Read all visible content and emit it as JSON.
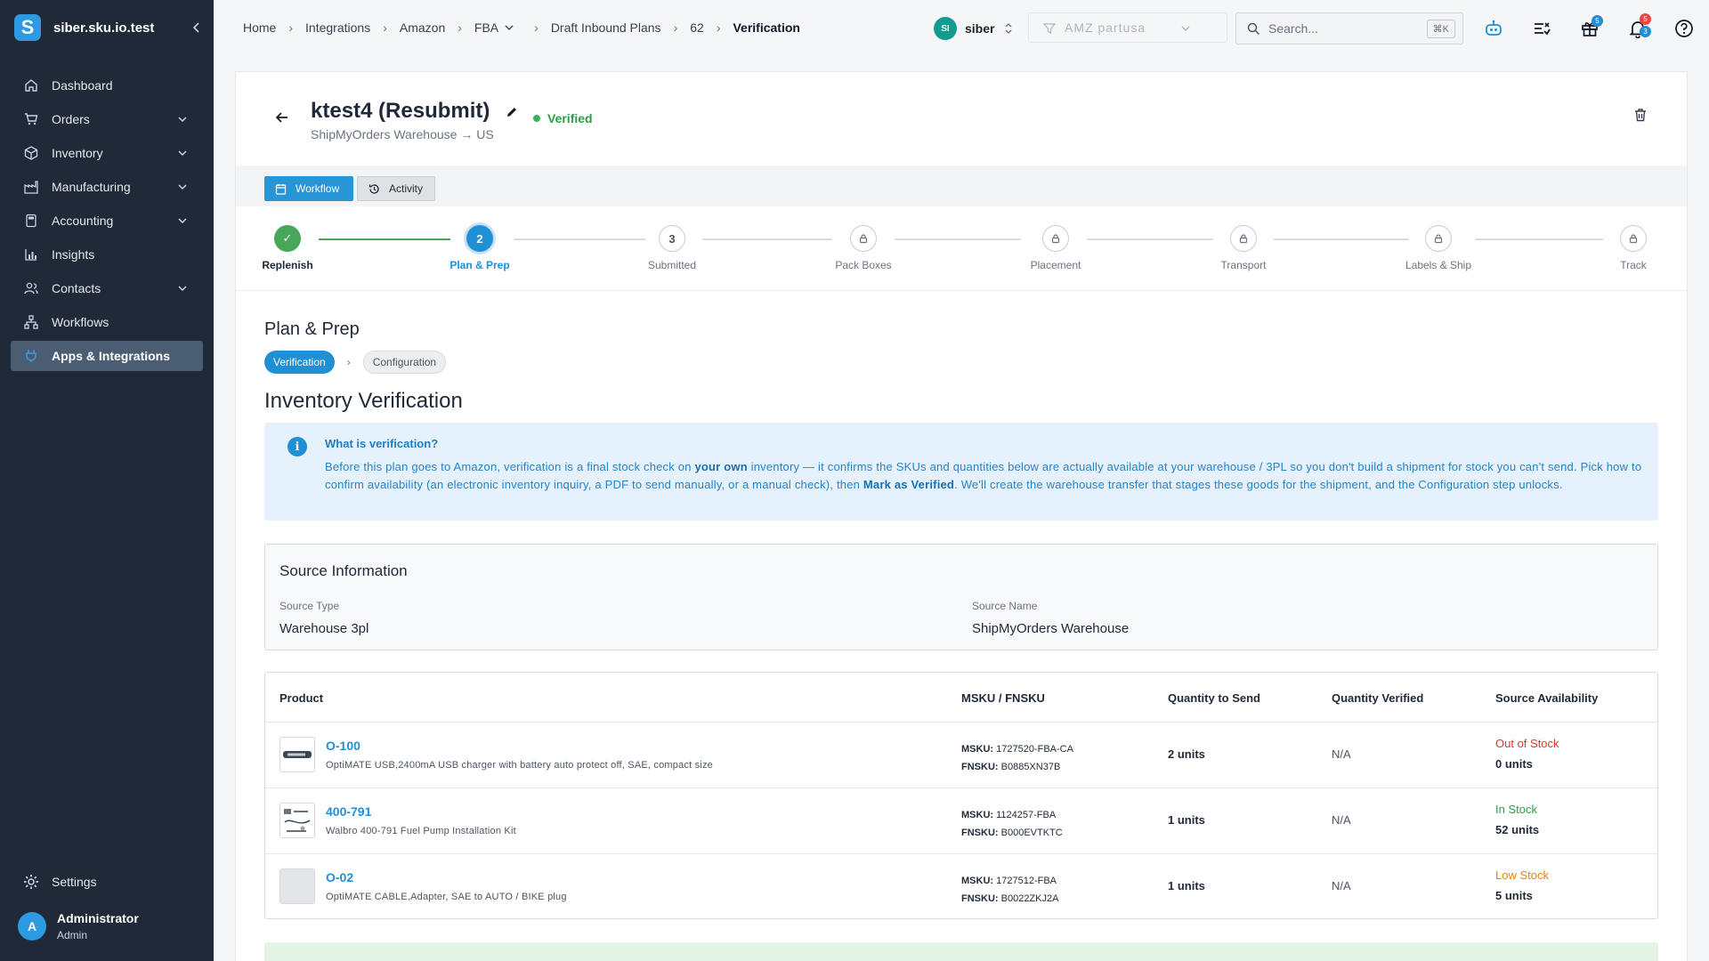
{
  "brand": {
    "name": "siber.sku.io.test",
    "logo_letter": "S",
    "collapse_icon": "chevron-left-icon"
  },
  "sidebar": {
    "items": [
      {
        "label": "Dashboard",
        "icon": "home-icon"
      },
      {
        "label": "Orders",
        "icon": "cart-icon",
        "has_children": true
      },
      {
        "label": "Inventory",
        "icon": "box-icon",
        "has_children": true
      },
      {
        "label": "Manufacturing",
        "icon": "factory-icon",
        "has_children": true
      },
      {
        "label": "Accounting",
        "icon": "calculator-icon",
        "has_children": true
      },
      {
        "label": "Insights",
        "icon": "bar-chart-icon"
      },
      {
        "label": "Contacts",
        "icon": "users-icon",
        "has_children": true
      },
      {
        "label": "Workflows",
        "icon": "workflow-icon"
      },
      {
        "label": "Apps & Integrations",
        "icon": "plug-icon",
        "active": true
      }
    ],
    "settings_label": "Settings",
    "user": {
      "initial": "A",
      "name": "Administrator",
      "role": "Admin"
    }
  },
  "topbar": {
    "breadcrumbs": [
      "Home",
      "Integrations",
      "Amazon",
      "FBA",
      "Draft Inbound Plans",
      "62",
      "Verification"
    ],
    "workspace": {
      "initials": "SI",
      "name": "siber"
    },
    "filter_placeholder": "AMZ partusa",
    "search_placeholder": "Search...",
    "search_shortcut": "⌘K",
    "gift_badge": "5",
    "notif_badge_red": "5",
    "notif_badge_blue": "3",
    "colors": {
      "accent": "#1f8fd6",
      "badge_red": "#ef4444"
    }
  },
  "plan": {
    "title": "ktest4 (Resubmit)",
    "route": "ShipMyOrders Warehouse → US",
    "status": "Verified",
    "tabs": {
      "workflow": "Workflow",
      "activity": "Activity"
    }
  },
  "steps": [
    {
      "label": "Replenish",
      "state": "done",
      "marker": "✓"
    },
    {
      "label": "Plan & Prep",
      "state": "active",
      "marker": "2"
    },
    {
      "label": "Submitted",
      "state": "todo",
      "marker": "3"
    },
    {
      "label": "Pack Boxes",
      "state": "locked"
    },
    {
      "label": "Placement",
      "state": "locked"
    },
    {
      "label": "Transport",
      "state": "locked"
    },
    {
      "label": "Labels & Ship",
      "state": "locked"
    },
    {
      "label": "Track",
      "state": "locked"
    }
  ],
  "section": {
    "title": "Plan & Prep",
    "subtabs": [
      "Verification",
      "Configuration"
    ],
    "heading": "Inventory Verification"
  },
  "info": {
    "title": "What is verification?",
    "body_1": "Before this plan goes to Amazon, verification is a final stock check on ",
    "body_bold_1": "your own",
    "body_2": " inventory — it confirms the SKUs and quantities below are actually available at your warehouse / 3PL so you don't build a shipment for stock you can't send. Pick how to confirm availability (an electronic inventory inquiry, a PDF to send manually, or a manual check), then ",
    "body_bold_2": "Mark as Verified",
    "body_3": ". We'll create the warehouse transfer that stages these goods for the shipment, and the Configuration step unlocks."
  },
  "source": {
    "title": "Source Information",
    "type_label": "Source Type",
    "type_value": "Warehouse 3pl",
    "name_label": "Source Name",
    "name_value": "ShipMyOrders Warehouse"
  },
  "table": {
    "headers": [
      "Product",
      "MSKU / FNSKU",
      "Quantity to Send",
      "Quantity Verified",
      "Source Availability"
    ],
    "rows": [
      {
        "sku": "O-100",
        "desc": "OptiMATE USB,2400mA USB charger with battery auto protect off, SAE, compact size",
        "msku_label": "MSKU:",
        "msku": "1727520-FBA-CA",
        "fnsku_label": "FNSKU:",
        "fnsku": "B0885XN37B",
        "qty": "2 units",
        "verified": "N/A",
        "status": "Out of Stock",
        "status_color": "#e5322d",
        "avail_units": "0 units",
        "thumb": "charger"
      },
      {
        "sku": "400-791",
        "desc": "Walbro 400-791 Fuel Pump Installation Kit",
        "msku_label": "MSKU:",
        "msku": "1124257-FBA",
        "fnsku_label": "FNSKU:",
        "fnsku": "B000EVTKTC",
        "qty": "1 units",
        "verified": "N/A",
        "status": "In Stock",
        "status_color": "#2e9d4a",
        "avail_units": "52 units",
        "thumb": "kit"
      },
      {
        "sku": "O-02",
        "desc": "OptiMATE CABLE,Adapter, SAE to AUTO / BIKE plug",
        "msku_label": "MSKU:",
        "msku": "1727512-FBA",
        "fnsku_label": "FNSKU:",
        "fnsku": "B0022ZKJ2A",
        "qty": "1 units",
        "verified": "N/A",
        "status": "Low Stock",
        "status_color": "#e8830c",
        "avail_units": "5 units",
        "thumb": "empty"
      }
    ]
  }
}
